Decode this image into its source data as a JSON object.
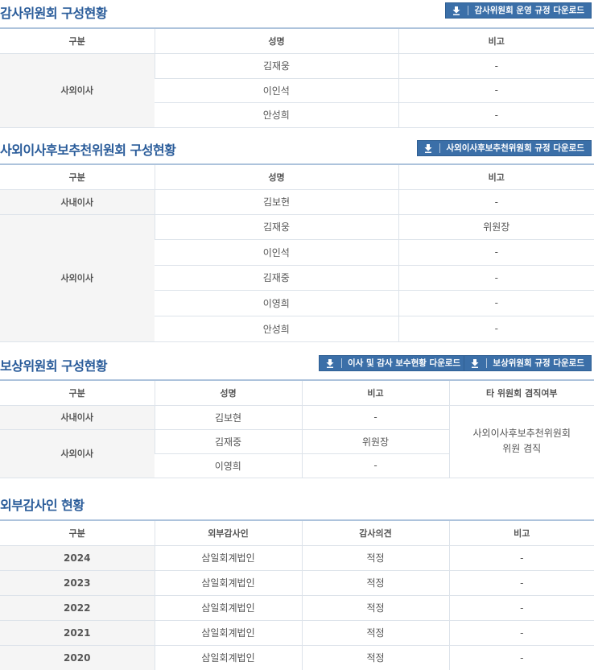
{
  "audit_committee": {
    "title": "감사위원회 구성현황",
    "download_label": "감사위원회 운영 규정 다운로드",
    "headers": [
      "구분",
      "성명",
      "비고"
    ],
    "group_label": "사외이사",
    "rows": [
      {
        "name": "김재웅",
        "note": "-"
      },
      {
        "name": "이인석",
        "note": "-"
      },
      {
        "name": "안성희",
        "note": "-"
      }
    ]
  },
  "nomination_committee": {
    "title": "사외이사후보추천위원회 구성현황",
    "download_label": "사외이사후보추천위원회 규정 다운로드",
    "headers": [
      "구분",
      "성명",
      "비고"
    ],
    "inside_label": "사내이사",
    "outside_label": "사외이사",
    "rows": [
      {
        "name": "김보현",
        "note": "-"
      },
      {
        "name": "김재웅",
        "note": "위원장"
      },
      {
        "name": "이인석",
        "note": "-"
      },
      {
        "name": "김재중",
        "note": "-"
      },
      {
        "name": "이영희",
        "note": "-"
      },
      {
        "name": "안성희",
        "note": "-"
      }
    ]
  },
  "compensation_committee": {
    "title": "보상위원회 구성현황",
    "download_label_1": "이사 및 감사 보수현황 다운로드",
    "download_label_2": "보상위원회 규정 다운로드",
    "headers": [
      "구분",
      "성명",
      "비고",
      "타 위원회 겸직여부"
    ],
    "inside_label": "사내이사",
    "outside_label": "사외이사",
    "rows": [
      {
        "name": "김보현",
        "note": "-"
      },
      {
        "name": "김재중",
        "note": "위원장"
      },
      {
        "name": "이영희",
        "note": "-"
      }
    ],
    "concurrent_line1": "사외이사후보추천위원회",
    "concurrent_line2": "위원 겸직"
  },
  "external_auditor": {
    "title": "외부감사인 현황",
    "headers": [
      "구분",
      "외부감사인",
      "감사의견",
      "비고"
    ],
    "rows": [
      {
        "year": "2024",
        "auditor": "삼일회계법인",
        "opinion": "적정",
        "note": "-"
      },
      {
        "year": "2023",
        "auditor": "삼일회계법인",
        "opinion": "적정",
        "note": "-"
      },
      {
        "year": "2022",
        "auditor": "삼일회계법인",
        "opinion": "적정",
        "note": "-"
      },
      {
        "year": "2021",
        "auditor": "삼일회계법인",
        "opinion": "적정",
        "note": "-"
      },
      {
        "year": "2020",
        "auditor": "삼일회계법인",
        "opinion": "적정",
        "note": "-"
      }
    ]
  }
}
